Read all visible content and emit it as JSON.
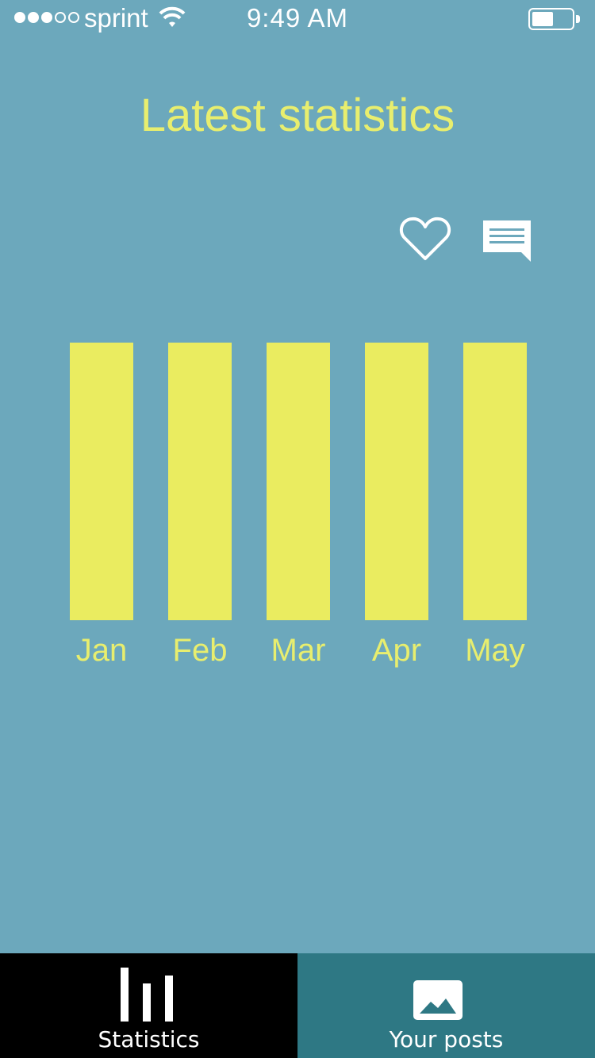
{
  "status_bar": {
    "carrier": "sprint",
    "time": "9:49 AM",
    "signal_bars_filled": 3,
    "signal_bars_total": 5,
    "battery_level": 0.55,
    "wifi_icon": "wifi-icon"
  },
  "header": {
    "title": "Latest statistics",
    "actions": [
      {
        "icon": "heart-icon",
        "label": "like"
      },
      {
        "icon": "comment-icon",
        "label": "comment"
      }
    ]
  },
  "chart_data": {
    "type": "bar",
    "categories": [
      "Jan",
      "Feb",
      "Mar",
      "Apr",
      "May"
    ],
    "values": [
      1,
      1,
      1,
      1,
      1
    ],
    "title": "",
    "xlabel": "",
    "ylabel": "",
    "ylim": [
      0,
      1
    ],
    "bar_color": "#eaec60",
    "label_color": "#e8ee6e"
  },
  "tab_bar": {
    "tabs": [
      {
        "label": "Statistics",
        "icon": "bar-chart-icon",
        "active": true
      },
      {
        "label": "Your posts",
        "icon": "image-icon",
        "active": false
      }
    ]
  },
  "colors": {
    "background": "#6ca8bc",
    "accent": "#e8ee6e",
    "tab_active_bg": "#000000",
    "tab_inactive_bg": "#2e7884"
  }
}
